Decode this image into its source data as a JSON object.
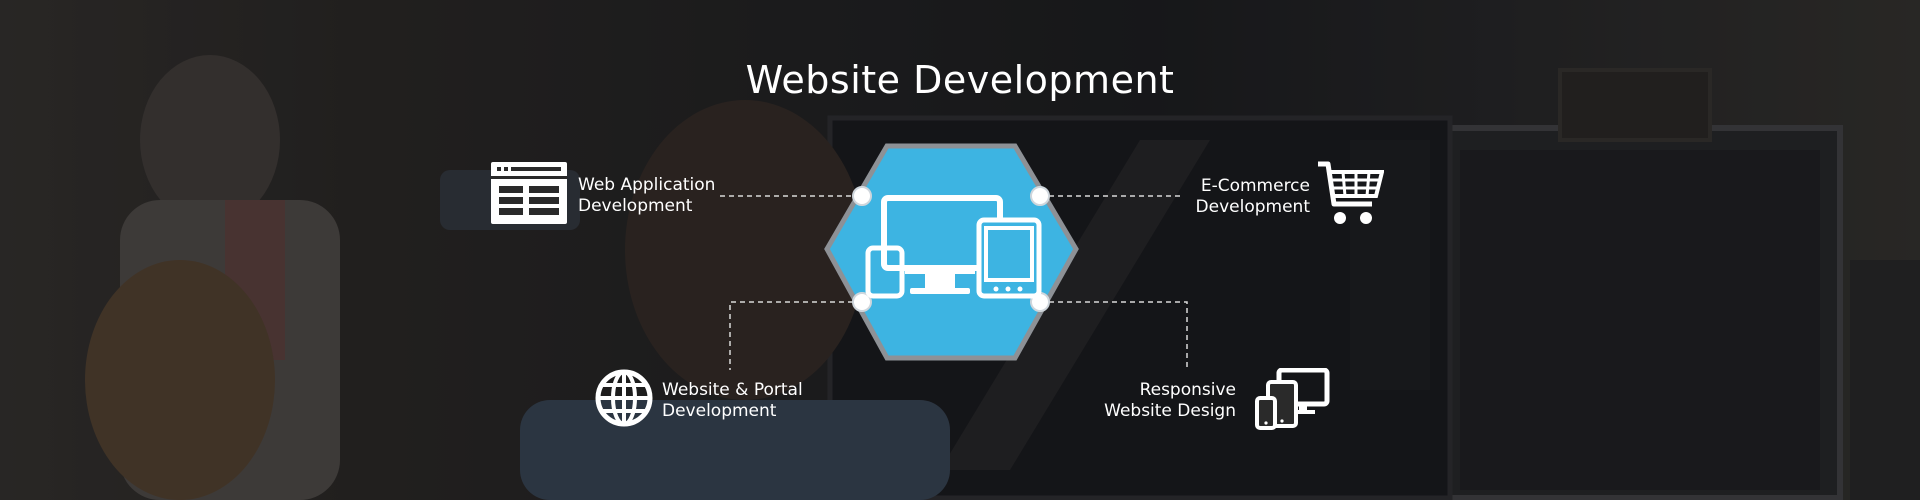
{
  "hero": {
    "title": "Website Development",
    "services": {
      "web_app": {
        "line1": "Web Application",
        "line2": "Development",
        "icon": "web-layout-icon"
      },
      "ecommerce": {
        "line1": "E-Commerce",
        "line2": "Development",
        "icon": "shopping-cart-icon"
      },
      "portal": {
        "line1": "Website & Portal",
        "line2": "Development",
        "icon": "globe-icon"
      },
      "responsive": {
        "line1": "Responsive",
        "line2": "Website Design",
        "icon": "devices-icon"
      }
    },
    "center_icon": "responsive-devices-icon",
    "colors": {
      "accent": "#3db4e2",
      "hex_border": "#8d9196",
      "text": "#ffffff"
    }
  }
}
